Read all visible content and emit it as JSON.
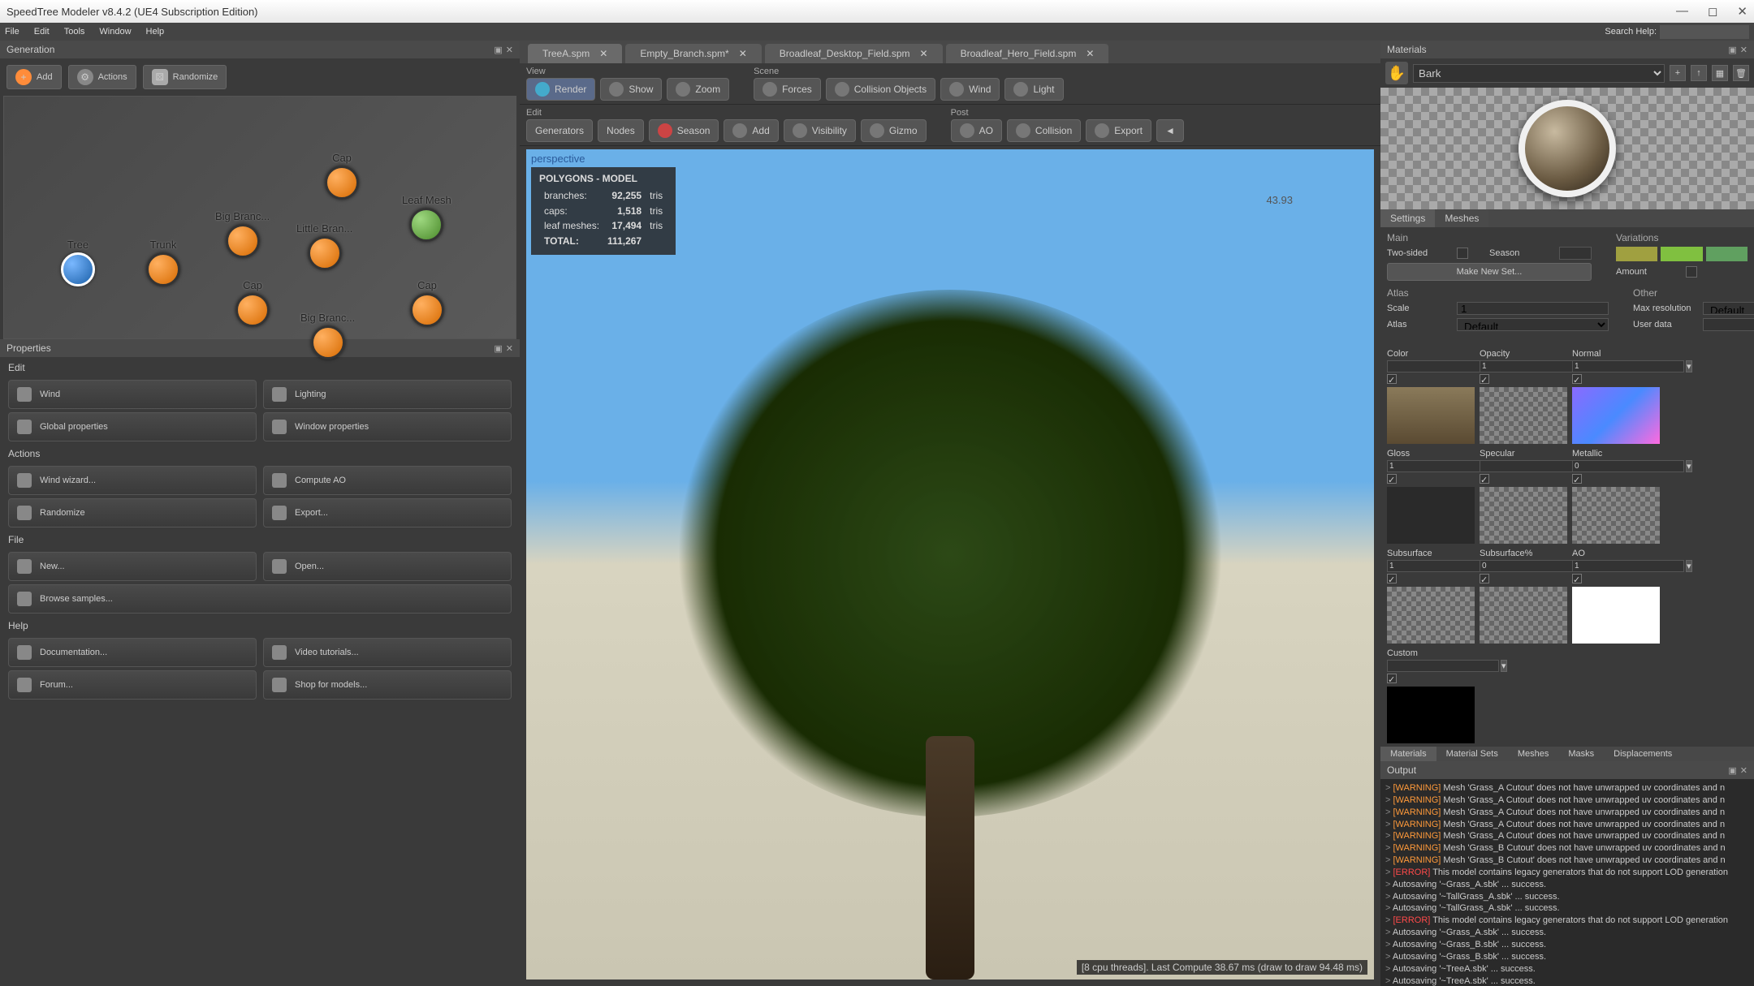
{
  "window": {
    "title": "SpeedTree Modeler v8.4.2 (UE4 Subscription Edition)"
  },
  "menubar": [
    "File",
    "Edit",
    "Tools",
    "Window",
    "Help"
  ],
  "search_label": "Search Help:",
  "generation": {
    "title": "Generation",
    "add": "Add",
    "actions": "Actions",
    "randomize": "Randomize",
    "nodes": {
      "tree": "Tree",
      "trunk": "Trunk",
      "big_branch1": "Big Branc...",
      "big_branch2": "Big Branc...",
      "little_branch": "Little Bran...",
      "cap1": "Cap",
      "cap2": "Cap",
      "cap3": "Cap",
      "leaf_mesh": "Leaf Mesh"
    }
  },
  "properties": {
    "title": "Properties",
    "edit_label": "Edit",
    "wind": "Wind",
    "lighting": "Lighting",
    "global": "Global properties",
    "windowp": "Window properties",
    "actions_label": "Actions",
    "wind_wizard": "Wind wizard...",
    "compute_ao": "Compute AO",
    "randomize": "Randomize",
    "export": "Export...",
    "file_label": "File",
    "new": "New...",
    "open": "Open...",
    "browse": "Browse samples...",
    "help_label": "Help",
    "documentation": "Documentation...",
    "video": "Video tutorials...",
    "forum": "Forum...",
    "shop": "Shop for models..."
  },
  "tabs": [
    {
      "label": "TreeA.spm",
      "active": true
    },
    {
      "label": "Empty_Branch.spm*",
      "active": false
    },
    {
      "label": "Broadleaf_Desktop_Field.spm",
      "active": false
    },
    {
      "label": "Broadleaf_Hero_Field.spm",
      "active": false
    }
  ],
  "toolbar": {
    "view": "View",
    "scene": "Scene",
    "edit": "Edit",
    "post": "Post",
    "render": "Render",
    "show": "Show",
    "zoom": "Zoom",
    "forces": "Forces",
    "collision_obj": "Collision Objects",
    "wind": "Wind",
    "light": "Light",
    "generators": "Generators",
    "nodes": "Nodes",
    "season": "Season",
    "add": "Add",
    "visibility": "Visibility",
    "gizmo": "Gizmo",
    "ao": "AO",
    "collision": "Collision",
    "export": "Export"
  },
  "viewport": {
    "mode": "perspective",
    "stats_hdr": "POLYGONS - MODEL",
    "stats": {
      "branches_lbl": "branches:",
      "branches": "92,255",
      "branches_sfx": "tris",
      "caps_lbl": "caps:",
      "caps": "1,518",
      "caps_sfx": "tris",
      "leaf_lbl": "leaf meshes:",
      "leaf": "17,494",
      "leaf_sfx": "tris",
      "total_lbl": "TOTAL:",
      "total": "111,267"
    },
    "coord": "43.93",
    "status": "[8 cpu threads]. Last Compute 38.67 ms (draw to draw 94.48 ms)"
  },
  "materials": {
    "title": "Materials",
    "selected": "Bark",
    "subtabs": [
      "Settings",
      "Meshes"
    ],
    "main_label": "Main",
    "variations_label": "Variations",
    "two_sided": "Two-sided",
    "season": "Season",
    "amount": "Amount",
    "make_new": "Make New Set...",
    "atlas_label": "Atlas",
    "other_label": "Other",
    "scale": "Scale",
    "scale_val": "1",
    "atlas": "Atlas",
    "atlas_val": "Default",
    "max_res": "Max resolution",
    "max_res_val": "Default",
    "user_data": "User data",
    "maps": {
      "color": {
        "label": "Color",
        "val": ""
      },
      "opacity": {
        "label": "Opacity",
        "val": "1"
      },
      "normal": {
        "label": "Normal",
        "val": "1"
      },
      "gloss": {
        "label": "Gloss",
        "val": "1"
      },
      "specular": {
        "label": "Specular",
        "val": ""
      },
      "metallic": {
        "label": "Metallic",
        "val": "0"
      },
      "subsurface": {
        "label": "Subsurface",
        "val": "1"
      },
      "subsurface_pct": {
        "label": "Subsurface%",
        "val": "0"
      },
      "ao": {
        "label": "AO",
        "val": "1"
      },
      "custom": {
        "label": "Custom",
        "val": ""
      }
    },
    "bottom_tabs": [
      "Materials",
      "Material Sets",
      "Meshes",
      "Masks",
      "Displacements"
    ]
  },
  "output": {
    "title": "Output",
    "lines": [
      {
        "tag": "WARNING",
        "text": "Mesh 'Grass_A Cutout' does not have unwrapped uv coordinates and n"
      },
      {
        "tag": "WARNING",
        "text": "Mesh 'Grass_A Cutout' does not have unwrapped uv coordinates and n"
      },
      {
        "tag": "WARNING",
        "text": "Mesh 'Grass_A Cutout' does not have unwrapped uv coordinates and n"
      },
      {
        "tag": "WARNING",
        "text": "Mesh 'Grass_A Cutout' does not have unwrapped uv coordinates and n"
      },
      {
        "tag": "WARNING",
        "text": "Mesh 'Grass_A Cutout' does not have unwrapped uv coordinates and n"
      },
      {
        "tag": "WARNING",
        "text": "Mesh 'Grass_B Cutout' does not have unwrapped uv coordinates and n"
      },
      {
        "tag": "WARNING",
        "text": "Mesh 'Grass_B Cutout' does not have unwrapped uv coordinates and n"
      },
      {
        "tag": "ERROR",
        "text": "This model contains legacy generators that do not support LOD generation"
      },
      {
        "tag": "",
        "text": "Autosaving '~Grass_A.sbk' ... success."
      },
      {
        "tag": "",
        "text": "Autosaving '~TallGrass_A.sbk' ... success."
      },
      {
        "tag": "",
        "text": "Autosaving '~TallGrass_A.sbk' ... success."
      },
      {
        "tag": "ERROR",
        "text": "This model contains legacy generators that do not support LOD generation"
      },
      {
        "tag": "",
        "text": "Autosaving '~Grass_A.sbk' ... success."
      },
      {
        "tag": "",
        "text": "Autosaving '~Grass_B.sbk' ... success."
      },
      {
        "tag": "",
        "text": "Autosaving '~Grass_B.sbk' ... success."
      },
      {
        "tag": "",
        "text": "Autosaving '~TreeA.sbk' ... success."
      },
      {
        "tag": "",
        "text": "Autosaving '~TreeA.sbk' ... success."
      }
    ]
  },
  "variation_colors": [
    "#a0a040",
    "#80c040",
    "#60a060"
  ],
  "season_color": "#303030"
}
